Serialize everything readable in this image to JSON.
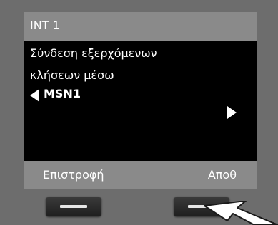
{
  "screen": {
    "header_title": "INT 1",
    "line1": "Σύνδεση εξερχόμενων",
    "line2": "κλήσεων μέσω",
    "selected_value": "MSN1",
    "softkey_left": "Επιστροφή",
    "softkey_right": "Αποθ"
  },
  "icons": {
    "left_arrow": "triangle-left-icon",
    "right_arrow": "triangle-right-icon",
    "pointer": "callout-pointer-icon",
    "hw_key_dash": "minus-icon"
  },
  "colors": {
    "device_body": "#6d6d6d",
    "bar": "#8a8a8a",
    "screen_bg": "#000000",
    "text": "#ffffff"
  }
}
